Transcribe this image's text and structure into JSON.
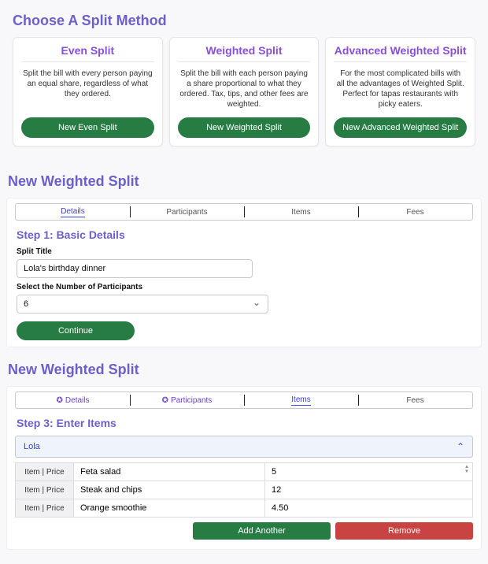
{
  "choose": {
    "heading": "Choose A Split Method",
    "cards": [
      {
        "title": "Even Split",
        "desc": "Split the bill with every person paying an equal share, regardless of what they ordered.",
        "button": "New Even Split"
      },
      {
        "title": "Weighted Split",
        "desc": "Split the bill with each person paying a share proportional to what they ordered. Tax, tips, and other fees are weighted.",
        "button": "New Weighted Split"
      },
      {
        "title": "Advanced Weighted Split",
        "desc": "For the most complicated bills with all the advantages of Weighted Split. Perfect for tapas restaurants with picky eaters.",
        "button": "New Advanced Weighted Split"
      }
    ]
  },
  "step1": {
    "heading": "New Weighted Split",
    "tabs": [
      "Details",
      "Participants",
      "Items",
      "Fees"
    ],
    "active_tab_index": 0,
    "step_label": "Step 1: Basic Details",
    "title_label": "Split Title",
    "title_value": "Lola's birthday dinner",
    "participants_label": "Select the Number of Participants",
    "participants_value": "6",
    "continue_label": "Continue"
  },
  "step3": {
    "heading": "New Weighted Split",
    "tabs": [
      {
        "label": "Details",
        "done": true
      },
      {
        "label": "Participants",
        "done": true
      },
      {
        "label": "Items",
        "active": true
      },
      {
        "label": "Fees"
      }
    ],
    "step_label": "Step 3: Enter Items",
    "expanded_name": "Lola",
    "row_label": "Item | Price",
    "rows": [
      {
        "item": "Feta salad",
        "price": "5"
      },
      {
        "item": "Steak and chips",
        "price": "12"
      },
      {
        "item": "Orange smoothie",
        "price": "4.50"
      }
    ],
    "add_label": "Add Another",
    "remove_label": "Remove"
  }
}
